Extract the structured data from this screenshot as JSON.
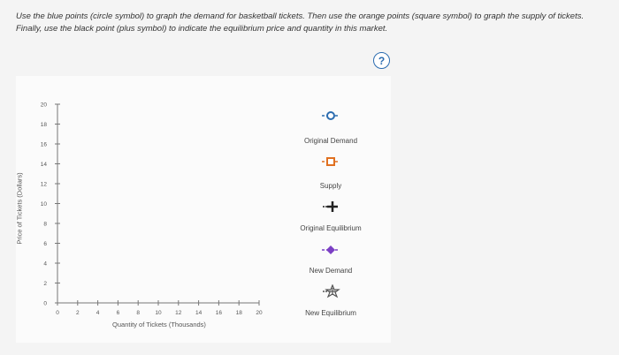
{
  "question": {
    "text": "Use the blue points (circle symbol) to graph the demand for basketball tickets. Then use the orange points (square symbol) to graph the supply of tickets. Finally, use the black point (plus symbol) to indicate the equilibrium price and quantity in this market."
  },
  "help": {
    "label": "?"
  },
  "graph": {
    "ylabel": "Price of Tickets (Dollars)",
    "xlabel": "Quantity of Tickets (Thousands)",
    "y_ticks": [
      "0",
      "2",
      "4",
      "6",
      "8",
      "10",
      "12",
      "14",
      "16",
      "18",
      "20"
    ],
    "x_ticks": [
      "0",
      "2",
      "4",
      "6",
      "8",
      "10",
      "12",
      "14",
      "16",
      "18",
      "20"
    ]
  },
  "legend": {
    "items": [
      {
        "name": "original-demand",
        "label": "Original Demand",
        "color": "#2b6cb0"
      },
      {
        "name": "supply",
        "label": "Supply",
        "color": "#e07020"
      },
      {
        "name": "original-equilibrium",
        "label": "Original Equilibrium",
        "color": "#222222"
      },
      {
        "name": "new-demand",
        "label": "New Demand",
        "color": "#7b3fc4"
      },
      {
        "name": "new-equilibrium",
        "label": "New Equilibrium",
        "color": "#555555"
      }
    ]
  }
}
